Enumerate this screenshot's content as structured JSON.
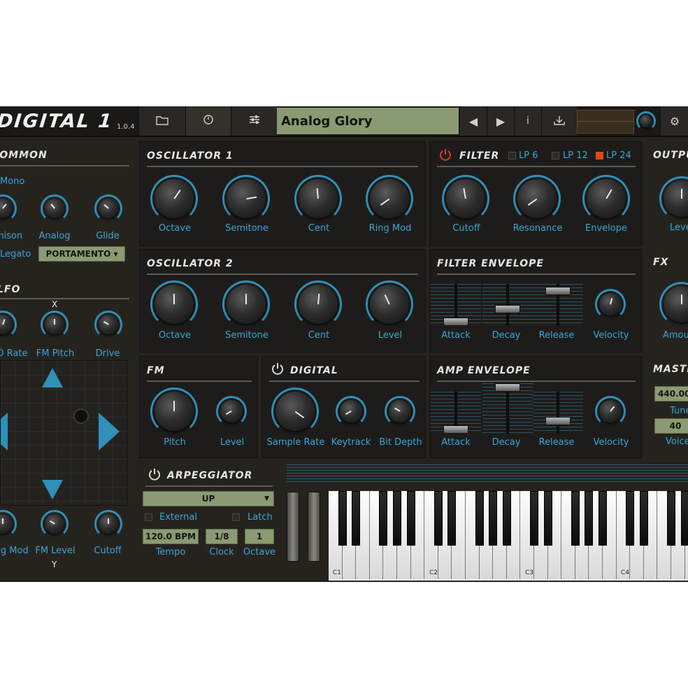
{
  "app": {
    "logo": "DIGITAL 1",
    "version": "1.0.4",
    "preset": "Analog Glory"
  },
  "toolbar": {
    "folder_icon": "folder-icon",
    "clock_icon": "clock-icon",
    "settings_icon": "sliders-icon",
    "prev": "◀",
    "next": "▶",
    "info": "i",
    "save_icon": "save-icon",
    "gear": "⚙"
  },
  "common": {
    "title": "COMMON",
    "mono": "Mono",
    "knobs": [
      "Unison",
      "Analog",
      "Glide"
    ],
    "legato": "Legato",
    "portamento": "PORTAMENTO ▾"
  },
  "lfo": {
    "title": "LFO",
    "x_label": "X",
    "y_label": "Y",
    "knobs": [
      "LFO Rate",
      "FM Pitch",
      "Drive"
    ],
    "bottom_knobs": [
      "Ring Mod",
      "FM Level",
      "Cutoff"
    ]
  },
  "osc1": {
    "title": "OSCILLATOR 1",
    "knobs": [
      "Octave",
      "Semitone",
      "Cent",
      "Ring Mod"
    ]
  },
  "osc2": {
    "title": "OSCILLATOR 2",
    "knobs": [
      "Octave",
      "Semitone",
      "Cent",
      "Level"
    ]
  },
  "filter": {
    "title": "FILTER",
    "modes": [
      "LP 6",
      "LP 12",
      "LP 24"
    ],
    "knobs": [
      "Cutoff",
      "Resonance",
      "Envelope"
    ]
  },
  "filter_env": {
    "title": "FILTER ENVELOPE",
    "faders": [
      "Attack",
      "Decay",
      "Release"
    ],
    "velocity": "Velocity"
  },
  "fm": {
    "title": "FM",
    "knobs": [
      "Pitch",
      "Level"
    ]
  },
  "digital": {
    "title": "DIGITAL",
    "knobs": [
      "Sample Rate",
      "Keytrack",
      "Bit Depth"
    ]
  },
  "amp_env": {
    "title": "AMP ENVELOPE",
    "faders": [
      "Attack",
      "Decay",
      "Release"
    ],
    "velocity": "Velocity"
  },
  "output": {
    "title": "OUTPUT",
    "knob": "Level"
  },
  "fx": {
    "title": "FX",
    "knob": "Amount"
  },
  "master": {
    "title": "MASTER",
    "tune_value": "440.00",
    "tune_label": "Tune",
    "voices_value": "40",
    "voices_label": "Voices"
  },
  "arp": {
    "title": "ARPEGGIATOR",
    "mode": "UP",
    "external": "External",
    "latch": "Latch",
    "tempo_value": "120.0 BPM",
    "tempo_label": "Tempo",
    "clock_value": "1/8",
    "clock_label": "Clock",
    "octave_value": "1",
    "octave_label": "Octave"
  },
  "keyboard": {
    "octaves": [
      "C1",
      "C2",
      "C3",
      "C4"
    ]
  },
  "colors": {
    "accent": "#3aa6d6",
    "panel": "#1e1c1a",
    "lcd": "#8a9a72",
    "power_on": "#d93a2b"
  }
}
